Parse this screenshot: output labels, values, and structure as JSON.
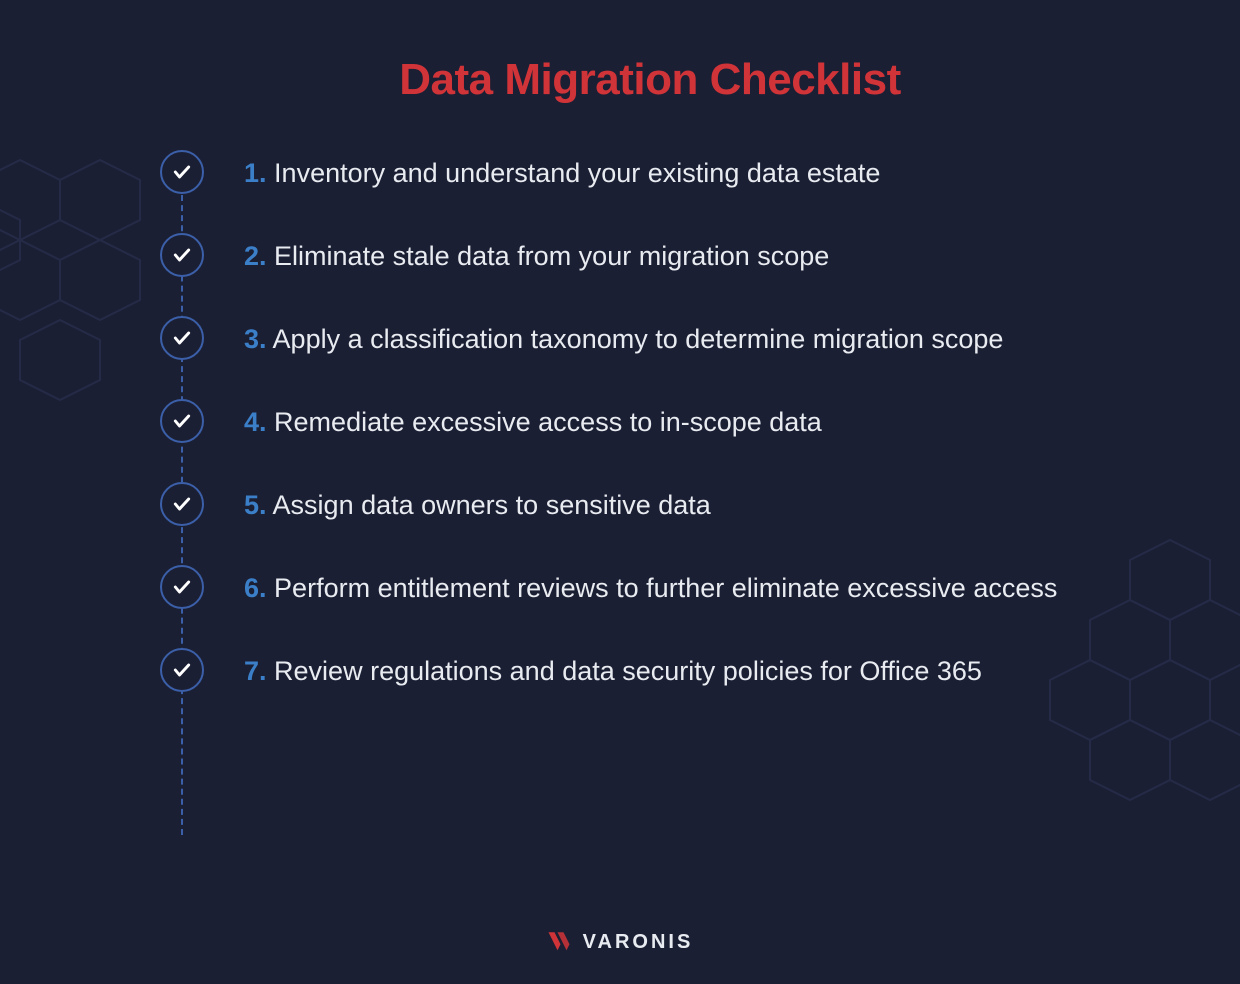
{
  "title": "Data Migration Checklist",
  "items": [
    {
      "num": "1.",
      "text": "Inventory and understand your existing data estate"
    },
    {
      "num": "2.",
      "text": "Eliminate stale data from your migration scope"
    },
    {
      "num": "3.",
      "text": "Apply a classification taxonomy to determine migration scope"
    },
    {
      "num": "4.",
      "text": "Remediate excessive access to in-scope data"
    },
    {
      "num": "5.",
      "text": "Assign data owners to sensitive data"
    },
    {
      "num": "6.",
      "text": "Perform entitlement reviews to further eliminate excessive access"
    },
    {
      "num": "7.",
      "text": "Review regulations and data security policies for Office 365"
    }
  ],
  "brand": "VARONIS"
}
